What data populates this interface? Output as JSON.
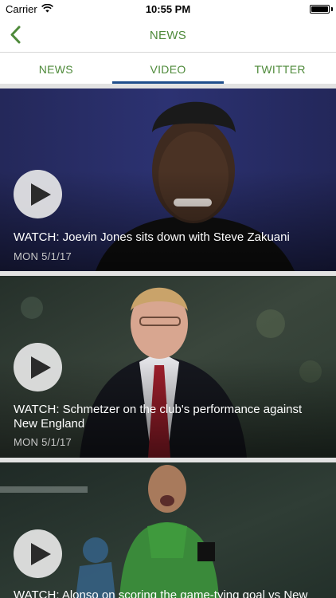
{
  "status_bar": {
    "carrier": "Carrier",
    "time": "10:55 PM"
  },
  "nav": {
    "title": "NEWS",
    "back_icon": "chevron-left-icon"
  },
  "tabs": [
    {
      "label": "NEWS",
      "active": false
    },
    {
      "label": "VIDEO",
      "active": true
    },
    {
      "label": "TWITTER",
      "active": false
    }
  ],
  "videos": [
    {
      "title": "WATCH: Joevin Jones sits down with Steve Zakuani",
      "date": "MON 5/1/17"
    },
    {
      "title": "WATCH: Schmetzer on the club's performance against New England",
      "date": "MON 5/1/17"
    },
    {
      "title": "WATCH: Alonso on scoring the game-tying goal vs New",
      "date": ""
    }
  ],
  "colors": {
    "accent_green": "#4e8a3a",
    "tab_indicator": "#1f4e8c"
  }
}
